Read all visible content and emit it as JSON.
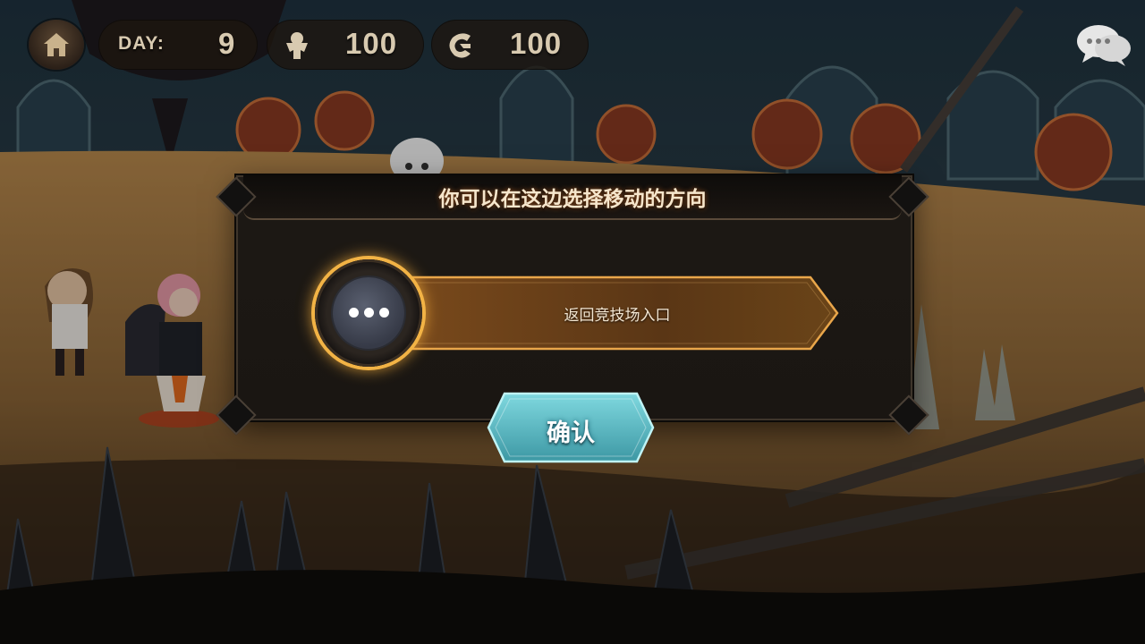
{
  "hud": {
    "day_label": "DAY:",
    "day_value": "9",
    "population_value": "100",
    "gold_value": "100"
  },
  "dialog": {
    "title": "你可以在这边选择移动的方向",
    "option_label": "返回竞技场入口",
    "confirm_label": "确认"
  },
  "colors": {
    "option_glow": "#f2b345",
    "confirm_teal": "#4fb7c2",
    "title_text": "#f6e6cc"
  },
  "icons": [
    "home-icon",
    "population-icon",
    "gold-icon",
    "chat-icon",
    "ellipsis-icon"
  ]
}
